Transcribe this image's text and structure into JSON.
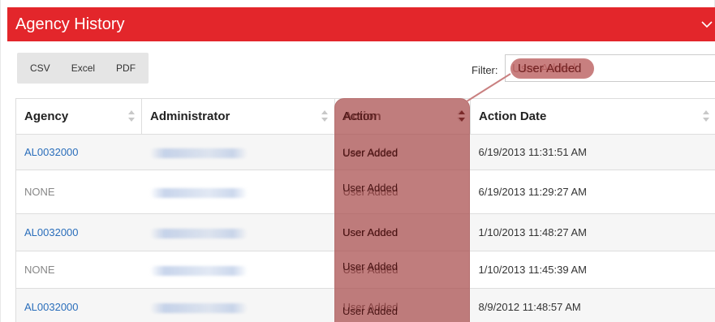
{
  "panel": {
    "title": "Agency History",
    "collapse_icon": "chevron-down-icon"
  },
  "toolbar": {
    "buttons": [
      "CSV",
      "Excel",
      "PDF"
    ]
  },
  "filter": {
    "label": "Filter:",
    "value": "User Added"
  },
  "table": {
    "headers": [
      "Agency",
      "Administrator",
      "Action",
      "Action Date"
    ],
    "sort_icon": "sort-both-icon",
    "rows": [
      {
        "agency": "AL0032000",
        "agency_is_link": true,
        "administrator": "Townsend, Tracy",
        "action": "User Added",
        "action_date": "6/19/2013 11:31:51 AM"
      },
      {
        "agency": "NONE",
        "agency_is_link": false,
        "administrator": "Townsend, Tracy",
        "action": "User Added",
        "action_date": "6/19/2013 11:29:27 AM"
      },
      {
        "agency": "AL0032000",
        "agency_is_link": true,
        "administrator": "Townsend, Tracy",
        "action": "User Added",
        "action_date": "1/10/2013 11:48:27 AM"
      },
      {
        "agency": "NONE",
        "agency_is_link": false,
        "administrator": "Townsend, Tracy",
        "action": "User Added",
        "action_date": "1/10/2013 11:45:39 AM"
      },
      {
        "agency": "AL0032000",
        "agency_is_link": true,
        "administrator": "Townsend, Tracy",
        "action": "User Added",
        "action_date": "8/9/2012 11:48:57 AM"
      }
    ]
  },
  "colors": {
    "header_bg": "#e3262b",
    "link": "#2a6ebb",
    "highlight": "#a84b4b"
  }
}
